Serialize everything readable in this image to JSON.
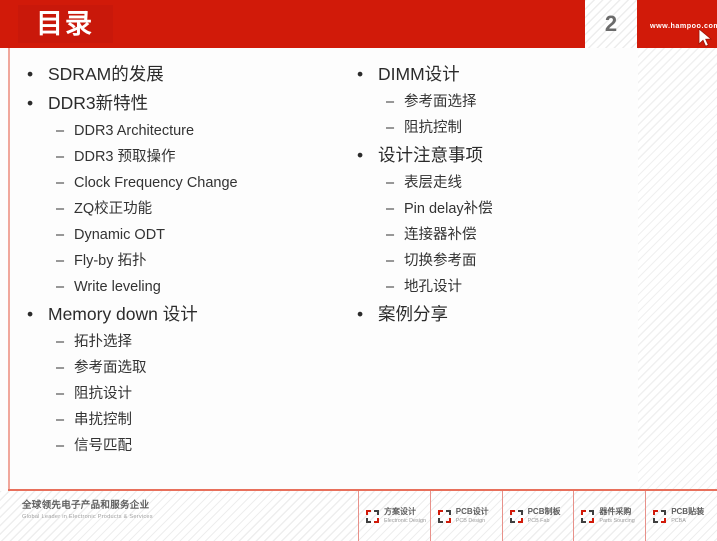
{
  "header": {
    "title": "目录",
    "page_number": "2",
    "site_url": "www.hampoo.com",
    "cursor_icon": "mouse-pointer-icon",
    "accent_color": "#d11a09"
  },
  "content": {
    "left_column": [
      {
        "level": 1,
        "text": "SDRAM的发展"
      },
      {
        "level": 1,
        "text": "DDR3新特性"
      },
      {
        "level": 2,
        "text": "DDR3 Architecture"
      },
      {
        "level": 2,
        "text": "DDR3 预取操作"
      },
      {
        "level": 2,
        "text": "Clock Frequency Change"
      },
      {
        "level": 2,
        "text": "ZQ校正功能"
      },
      {
        "level": 2,
        "text": "Dynamic ODT"
      },
      {
        "level": 2,
        "text": "Fly-by 拓扑"
      },
      {
        "level": 2,
        "text": "Write leveling"
      },
      {
        "level": 1,
        "text": "Memory down 设计"
      },
      {
        "level": 2,
        "text": "拓扑选择"
      },
      {
        "level": 2,
        "text": "参考面选取"
      },
      {
        "level": 2,
        "text": "阻抗设计"
      },
      {
        "level": 2,
        "text": "串扰控制"
      },
      {
        "level": 2,
        "text": "信号匹配"
      }
    ],
    "right_column": [
      {
        "level": 1,
        "text": "DIMM设计"
      },
      {
        "level": 2,
        "text": "参考面选择"
      },
      {
        "level": 2,
        "text": "阻抗控制"
      },
      {
        "level": 1,
        "text": "设计注意事项"
      },
      {
        "level": 2,
        "text": "表层走线"
      },
      {
        "level": 2,
        "text": "Pin delay补偿"
      },
      {
        "level": 2,
        "text": "连接器补偿"
      },
      {
        "level": 2,
        "text": "切换参考面"
      },
      {
        "level": 2,
        "text": "地孔设计"
      },
      {
        "level": 1,
        "text": "案例分享"
      }
    ],
    "bullet_glyph_l1": "•",
    "bullet_glyph_l2": "–"
  },
  "footer": {
    "brand_cn": "全球领先电子产品和服务企业",
    "brand_en": "Global Leader in Electronic Products & Services",
    "items": [
      {
        "cn": "方案设计",
        "en": "Electronic Design",
        "icon": "corner-brackets-icon"
      },
      {
        "cn": "PCB设计",
        "en": "PCB Design",
        "icon": "corner-brackets-icon"
      },
      {
        "cn": "PCB制板",
        "en": "PCB Fab",
        "icon": "corner-brackets-icon"
      },
      {
        "cn": "器件采购",
        "en": "Parts Sourcing",
        "icon": "corner-brackets-icon"
      },
      {
        "cn": "PCB贴装",
        "en": "PCBA",
        "icon": "corner-brackets-icon"
      }
    ]
  }
}
